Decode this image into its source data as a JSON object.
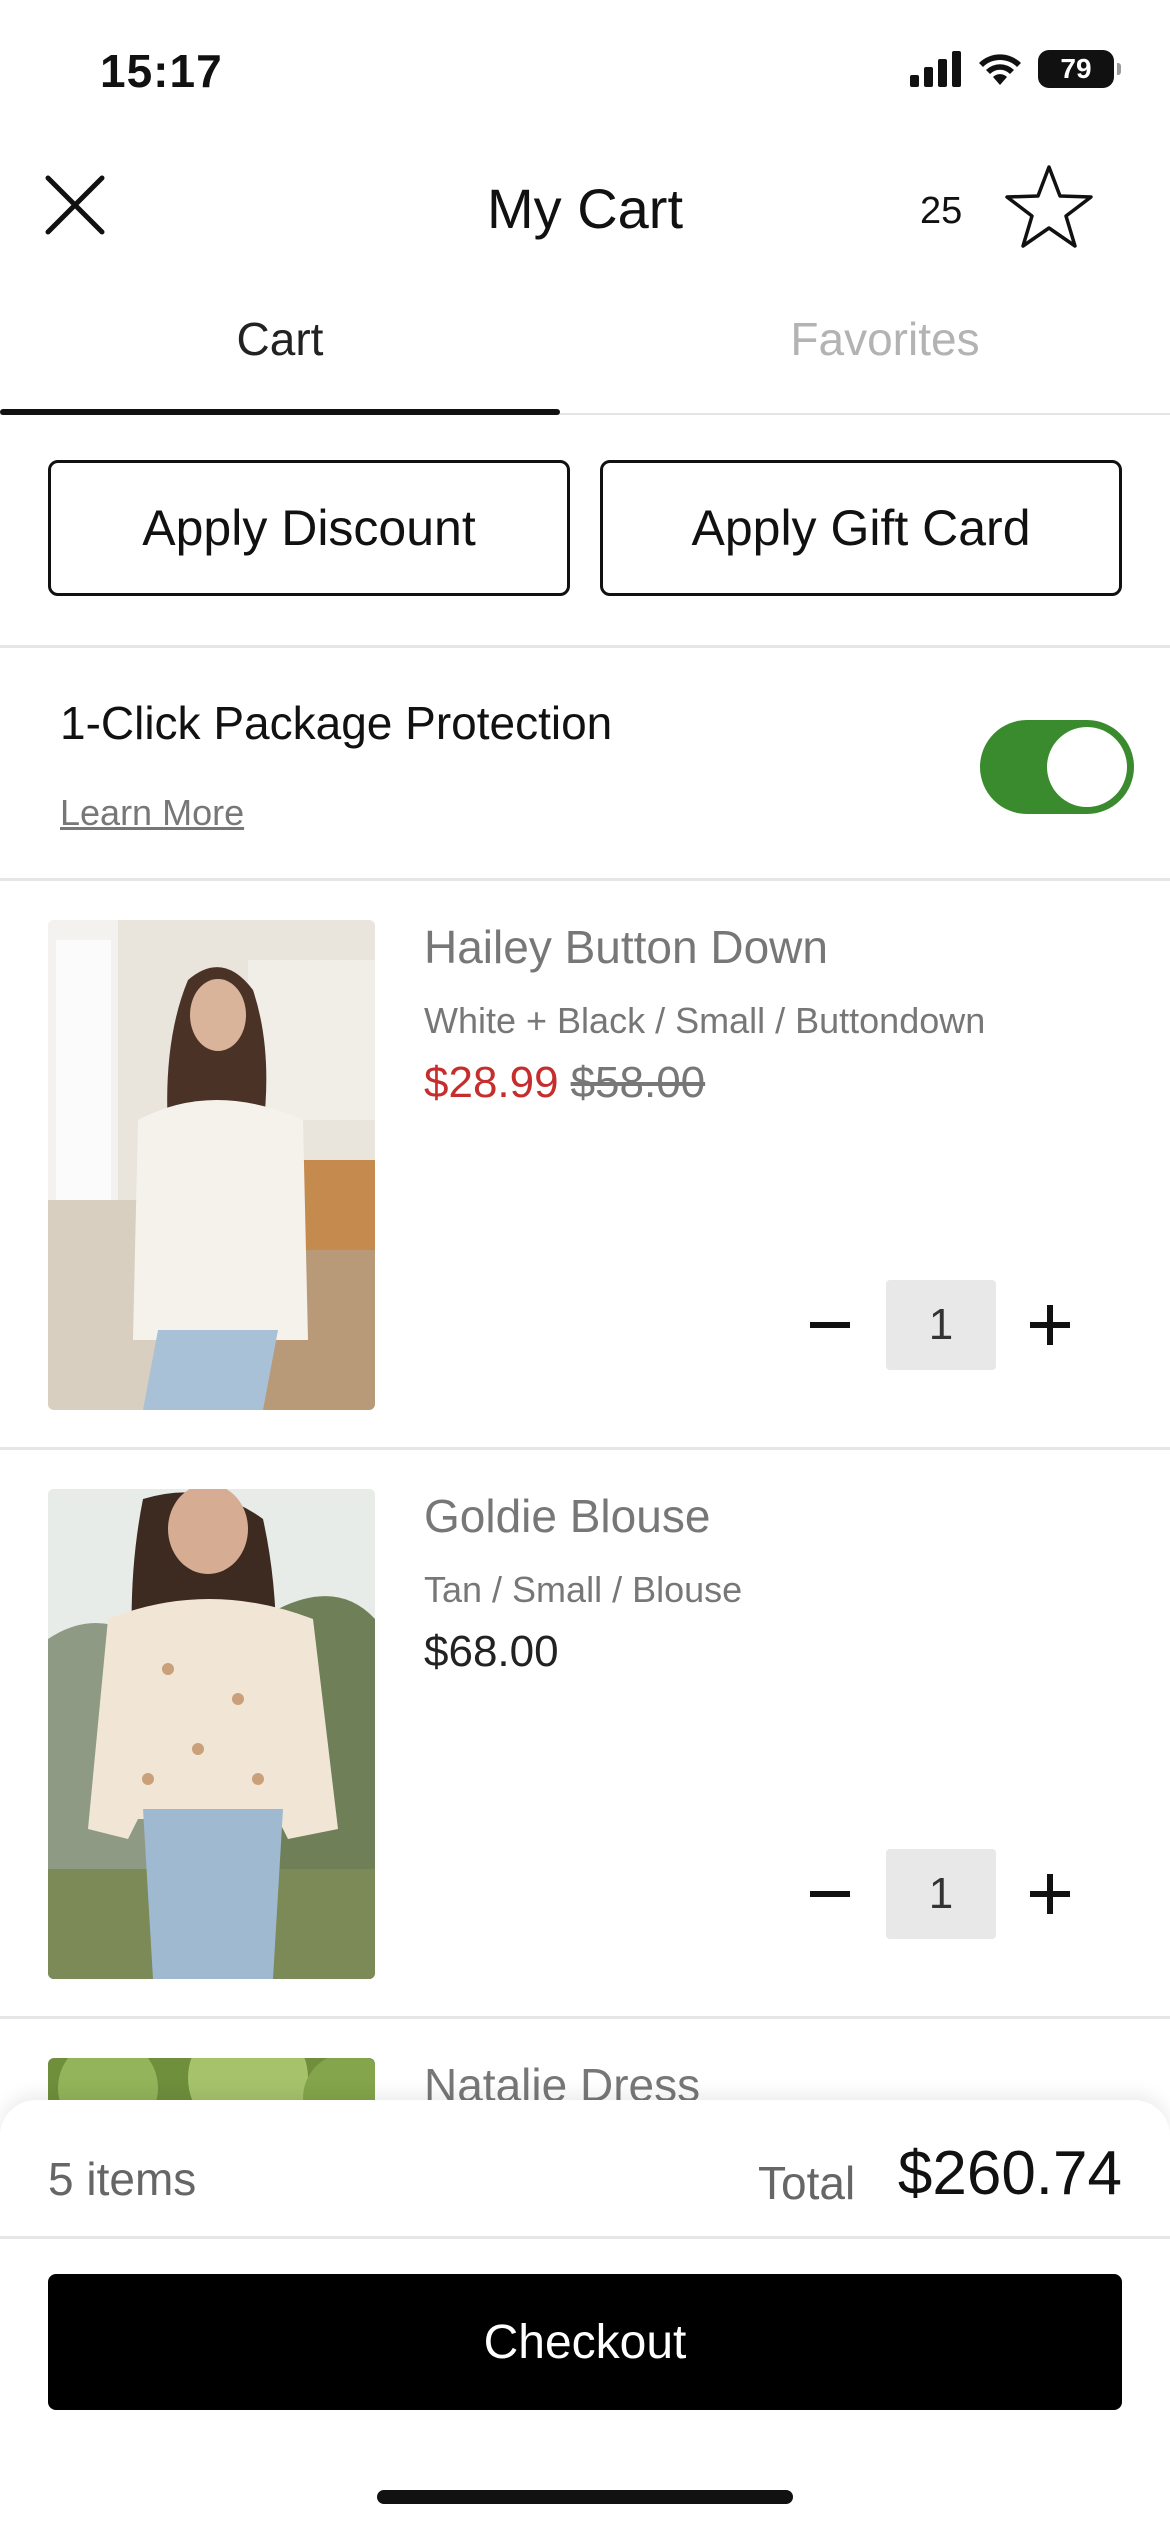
{
  "status_bar": {
    "time": "15:17",
    "battery": "79"
  },
  "header": {
    "title": "My Cart",
    "favorites_count": "25"
  },
  "tabs": [
    {
      "label": "Cart",
      "active": true
    },
    {
      "label": "Favorites",
      "active": false
    }
  ],
  "actions": {
    "discount_label": "Apply Discount",
    "gift_card_label": "Apply Gift Card"
  },
  "protection": {
    "title": "1-Click Package Protection",
    "learn_more": "Learn More",
    "enabled": true
  },
  "items": [
    {
      "name": "Hailey Button Down",
      "variant": "White + Black / Small / Buttondown",
      "sale_price": "$28.99",
      "original_price": "$58.00",
      "quantity": "1"
    },
    {
      "name": "Goldie Blouse",
      "variant": "Tan / Small / Blouse",
      "price": "$68.00",
      "quantity": "1"
    },
    {
      "name": "Natalie Dress"
    }
  ],
  "summary": {
    "items_count": "5 items",
    "total_label": "Total",
    "total_value": "$260.74",
    "checkout_label": "Checkout"
  },
  "colors": {
    "sale_red": "#c62e2e",
    "toggle_green": "#3a8a2e"
  }
}
